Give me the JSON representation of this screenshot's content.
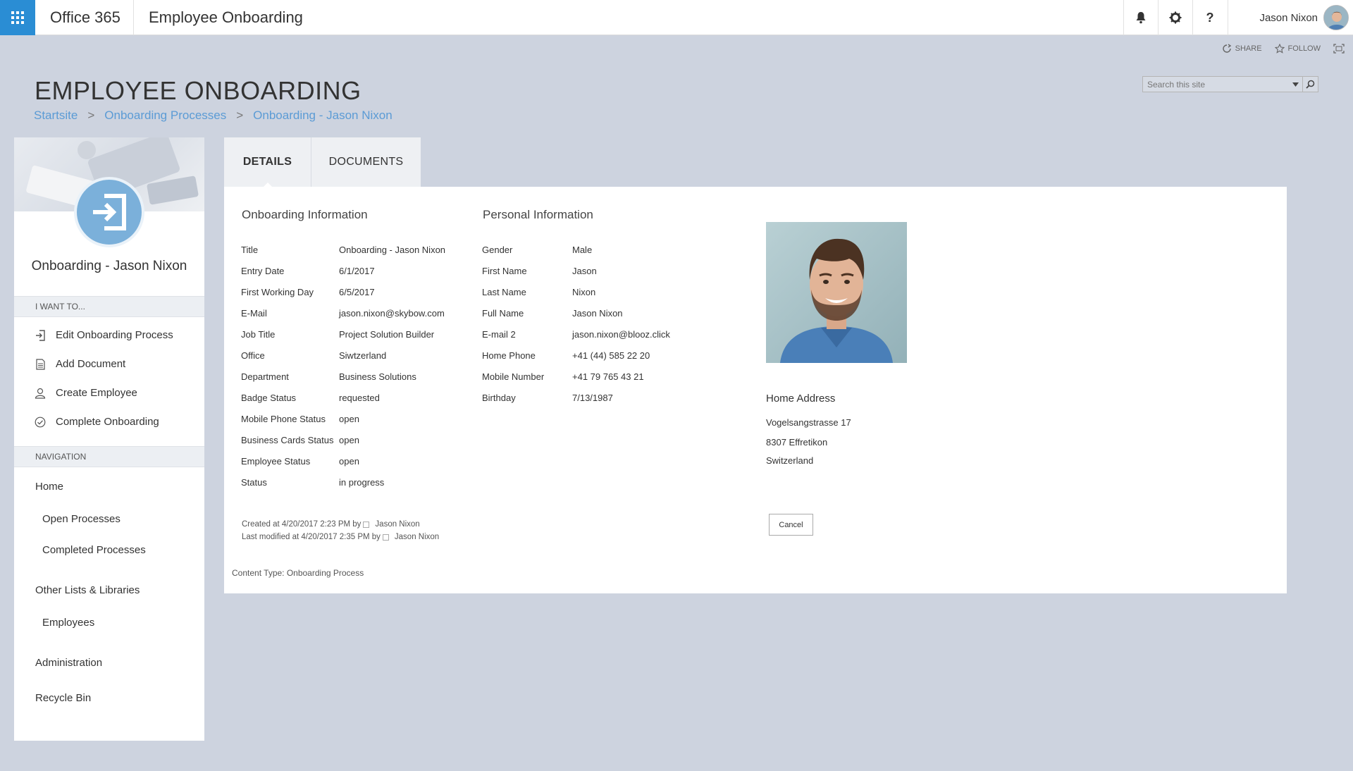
{
  "suite": {
    "brand": "Office 365",
    "site_title": "Employee Onboarding",
    "user_name": "Jason Nixon",
    "help_glyph": "?"
  },
  "actions": {
    "share": "SHARE",
    "follow": "FOLLOW"
  },
  "header": {
    "page_title": "EMPLOYEE ONBOARDING",
    "breadcrumb": [
      "Startsite",
      "Onboarding Processes",
      "Onboarding - Jason Nixon"
    ],
    "breadcrumb_sep": ">",
    "search_placeholder": "Search this site"
  },
  "left": {
    "process_title": "Onboarding - Jason Nixon",
    "i_want_header": "I WANT TO...",
    "i_want": [
      {
        "label": "Edit Onboarding Process",
        "icon": "edit-process-icon"
      },
      {
        "label": "Add Document",
        "icon": "document-icon"
      },
      {
        "label": "Create Employee",
        "icon": "person-icon"
      },
      {
        "label": "Complete Onboarding",
        "icon": "check-circle-icon"
      }
    ],
    "nav_header": "NAVIGATION",
    "nav": [
      {
        "label": "Home",
        "level": 1
      },
      {
        "label": "Open Processes",
        "level": 2
      },
      {
        "label": "Completed Processes",
        "level": 2
      },
      {
        "label": "Other Lists & Libraries",
        "level": 1
      },
      {
        "label": "Employees",
        "level": 2
      },
      {
        "label": "Administration",
        "level": 1
      },
      {
        "label": "Recycle Bin",
        "level": 1
      }
    ]
  },
  "tabs": [
    {
      "label": "DETAILS",
      "active": true
    },
    {
      "label": "DOCUMENTS",
      "active": false
    }
  ],
  "onboarding": {
    "title": "Onboarding Information",
    "fields": [
      {
        "label": "Title",
        "value": "Onboarding - Jason Nixon"
      },
      {
        "label": "Entry Date",
        "value": "6/1/2017"
      },
      {
        "label": "First Working Day",
        "value": "6/5/2017"
      },
      {
        "label": "E-Mail",
        "value": "jason.nixon@skybow.com"
      },
      {
        "label": "Job Title",
        "value": "Project Solution Builder"
      },
      {
        "label": "Office",
        "value": "Siwtzerland"
      },
      {
        "label": "Department",
        "value": "Business Solutions"
      },
      {
        "label": "Badge Status",
        "value": "requested"
      },
      {
        "label": "Mobile Phone Status",
        "value": "open"
      },
      {
        "label": "Business Cards Status",
        "value": "open"
      },
      {
        "label": "Employee Status",
        "value": "open"
      },
      {
        "label": "Status",
        "value": "in progress"
      }
    ]
  },
  "personal": {
    "title": "Personal Information",
    "fields": [
      {
        "label": "Gender",
        "value": "Male"
      },
      {
        "label": "First Name",
        "value": "Jason"
      },
      {
        "label": "Last Name",
        "value": "Nixon"
      },
      {
        "label": "Full Name",
        "value": "Jason Nixon"
      },
      {
        "label": "E-mail 2",
        "value": "jason.nixon@blooz.click"
      },
      {
        "label": "Home Phone",
        "value": "+41 (44) 585 22 20"
      },
      {
        "label": "Mobile Number",
        "value": "+41 79 765 43 21"
      },
      {
        "label": "Birthday",
        "value": "7/13/1987"
      }
    ]
  },
  "address": {
    "title": "Home Address",
    "lines": [
      "Vogelsangstrasse 17",
      "8307  Effretikon",
      "Switzerland"
    ]
  },
  "meta": {
    "created": "Created at 4/20/2017 2:23 PM by",
    "created_by": "Jason Nixon",
    "modified": "Last modified at 4/20/2017 2:35 PM by",
    "modified_by": "Jason Nixon",
    "content_type": "Content Type: Onboarding Process"
  },
  "buttons": {
    "cancel": "Cancel"
  },
  "colors": {
    "accent": "#2a8dd4",
    "link": "#5b9bd5",
    "page_bg": "#cdd3df"
  }
}
